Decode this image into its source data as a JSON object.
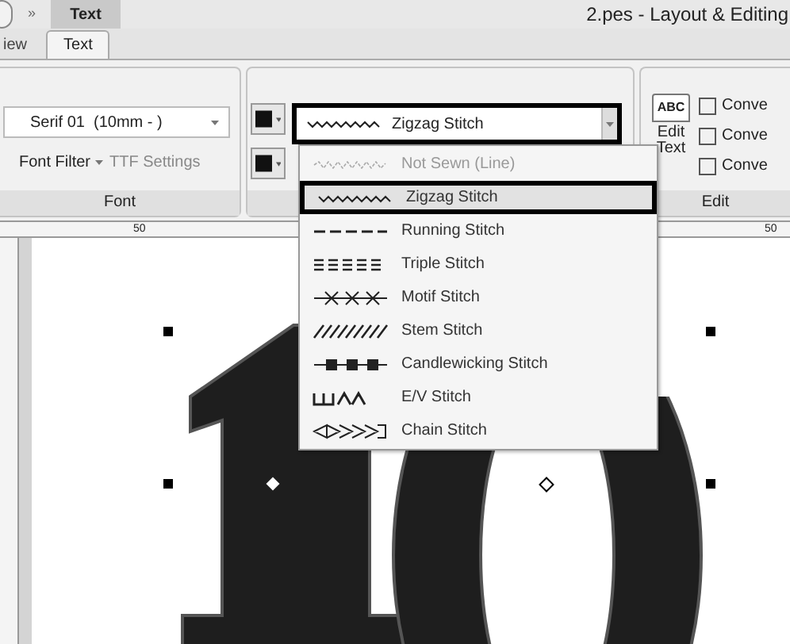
{
  "title_bar": {
    "quick_access": "»",
    "context_tab": "Text",
    "title": "2.pes - Layout & Editing"
  },
  "tabs": [
    {
      "label": "iew",
      "selected": false
    },
    {
      "label": "Text",
      "selected": true
    }
  ],
  "font_group": {
    "font": "Serif 01  (10mm - )",
    "font_filter": "Font Filter",
    "ttf_settings": "TTF Settings",
    "label": "Font"
  },
  "stitch_group": {
    "stitch": "Zigzag Stitch"
  },
  "edit_group": {
    "edit_text": "Edit Text",
    "icon_text": "ABC",
    "convert_items": [
      "Conve",
      "Conve",
      "Conve"
    ],
    "label": "Edit"
  },
  "ruler": {
    "labels": [
      "50",
      "50"
    ]
  },
  "stitch_menu": [
    {
      "label": "Not Sewn (Line)",
      "kind": "not_sewn",
      "selected": false,
      "disabled": true
    },
    {
      "label": "Zigzag Stitch",
      "kind": "zigzag",
      "selected": true,
      "disabled": false
    },
    {
      "label": "Running Stitch",
      "kind": "running",
      "selected": false,
      "disabled": false
    },
    {
      "label": "Triple Stitch",
      "kind": "triple",
      "selected": false,
      "disabled": false
    },
    {
      "label": "Motif Stitch",
      "kind": "motif",
      "selected": false,
      "disabled": false
    },
    {
      "label": "Stem Stitch",
      "kind": "stem",
      "selected": false,
      "disabled": false
    },
    {
      "label": "Candlewicking Stitch",
      "kind": "candlewicking",
      "selected": false,
      "disabled": false
    },
    {
      "label": "E/V Stitch",
      "kind": "ev",
      "selected": false,
      "disabled": false
    },
    {
      "label": "Chain Stitch",
      "kind": "chain",
      "selected": false,
      "disabled": false
    }
  ]
}
